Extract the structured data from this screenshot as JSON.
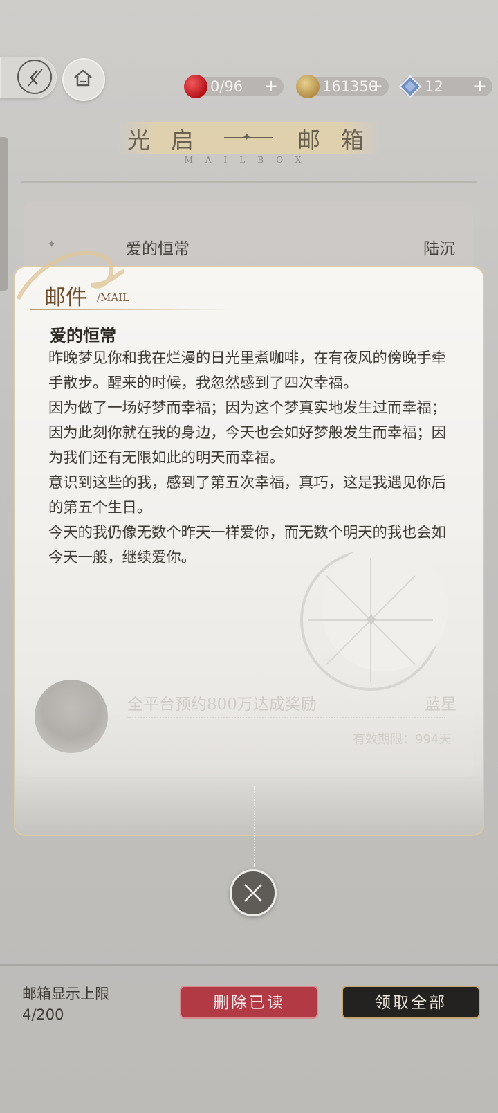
{
  "topbar": {
    "back_icon": "back-arrow-icon",
    "home_icon": "home-icon",
    "resources": [
      {
        "icon": "apple-icon",
        "value": "0/96",
        "plus": "+"
      },
      {
        "icon": "coin-icon",
        "value": "161350",
        "plus": "+"
      },
      {
        "icon": "diamond-icon",
        "value": "12",
        "plus": "+"
      }
    ]
  },
  "header": {
    "title_left": "光启",
    "title_right": "邮箱",
    "subtitle": "MAILBOX"
  },
  "mail_list": [
    {
      "title": "爱的恒常",
      "sender": "陆沉"
    },
    {
      "title": "全平台预约800万达成奖励",
      "sender": "蓝星",
      "expire": "有效期限：994天"
    }
  ],
  "mail_detail": {
    "label": "邮件",
    "label_sub": "/MAIL",
    "title": "爱的恒常",
    "paragraphs": [
      "昨晚梦见你和我在烂漫的日光里煮咖啡，在有夜风的傍晚手牵手散步。醒来的时候，我忽然感到了四次幸福。",
      "因为做了一场好梦而幸福；因为这个梦真实地发生过而幸福；因为此刻你就在我的身边，今天也会如好梦般发生而幸福；因为我们还有无限如此的明天而幸福。",
      "意识到这些的我，感到了第五次幸福，真巧，这是我遇见你后的第五个生日。",
      "今天的我仍像无数个昨天一样爱你，而无数个明天的我也会如今天一般，继续爱你。"
    ]
  },
  "footer": {
    "limit_label": "邮箱显示上限",
    "limit_count": "4/200",
    "delete_label": "删除已读",
    "claim_label": "领取全部"
  },
  "colors": {
    "delete": "#b23a45",
    "claim": "#232221",
    "gold": "#c5a66f"
  }
}
